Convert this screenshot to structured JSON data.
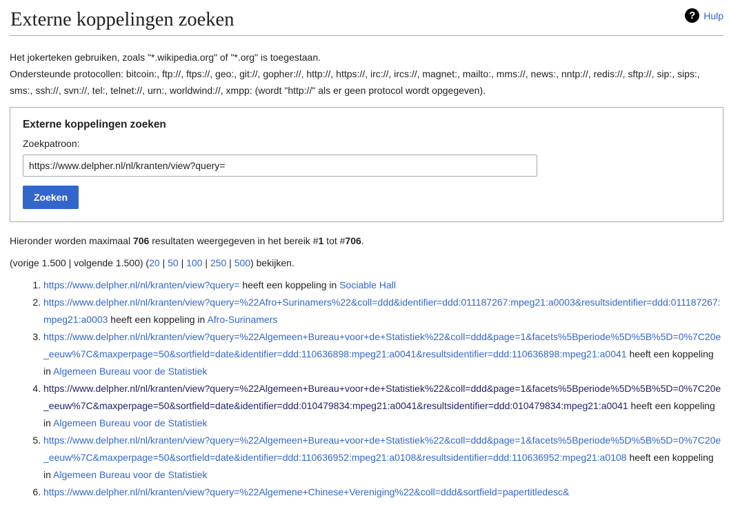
{
  "page": {
    "title": "Externe koppelingen zoeken",
    "help_label": "Hulp",
    "intro_line1": "Het jokerteken gebruiken, zoals \"*.wikipedia.org\" of \"*.org\" is toegestaan.",
    "intro_line2": "Ondersteunde protocollen: bitcoin:, ftp://, ftps://, geo:, git://, gopher://, http://, https://, irc://, ircs://, magnet:, mailto:, mms://, news:, nntp://, redis://, sftp://, sip:, sips:, sms:, ssh://, svn://, tel:, telnet://, urn:, worldwind://, xmpp: (wordt \"http://\" als er geen protocol wordt opgegeven)."
  },
  "form": {
    "legend": "Externe koppelingen zoeken",
    "field_label": "Zoekpatroon:",
    "field_value": "https://www.delpher.nl/nl/kranten/view?query=",
    "submit_label": "Zoeken"
  },
  "summary": {
    "prefix": "Hieronder worden maximaal ",
    "count": "706",
    "middle": " resultaten weergegeven in het bereik #",
    "from": "1",
    "between": " tot #",
    "to": "706",
    "suffix": "."
  },
  "paging": {
    "open": "(vorige 1.500 | volgende 1.500) (",
    "sizes": [
      "20",
      "50",
      "100",
      "250",
      "500"
    ],
    "sep": " | ",
    "close": ") bekijken."
  },
  "results": {
    "connector": " heeft een koppeling in ",
    "items": [
      {
        "url": "https://www.delpher.nl/nl/kranten/view?query=",
        "page": "Sociable Hall",
        "visited": false
      },
      {
        "url": "https://www.delpher.nl/nl/kranten/view?query=%22Afro+Surinamers%22&coll=ddd&identifier=ddd:011187267:mpeg21:a0003&resultsidentifier=ddd:011187267:mpeg21:a0003",
        "page": "Afro-Surinamers",
        "visited": false
      },
      {
        "url": "https://www.delpher.nl/nl/kranten/view?query=%22Algemeen+Bureau+voor+de+Statistiek%22&coll=ddd&page=1&facets%5Bperiode%5D%5B%5D=0%7C20e_eeuw%7C&maxperpage=50&sortfield=date&identifier=ddd:110636898:mpeg21:a0041&resultsidentifier=ddd:110636898:mpeg21:a0041",
        "page": "Algemeen Bureau voor de Statistiek",
        "visited": false
      },
      {
        "url": "https://www.delpher.nl/nl/kranten/view?query=%22Algemeen+Bureau+voor+de+Statistiek%22&coll=ddd&page=1&facets%5Bperiode%5D%5B%5D=0%7C20e_eeuw%7C&maxperpage=50&sortfield=date&identifier=ddd:010479834:mpeg21:a0041&resultsidentifier=ddd:010479834:mpeg21:a0041",
        "page": "Algemeen Bureau voor de Statistiek",
        "visited": true
      },
      {
        "url": "https://www.delpher.nl/nl/kranten/view?query=%22Algemeen+Bureau+voor+de+Statistiek%22&coll=ddd&page=1&facets%5Bperiode%5D%5B%5D=0%7C20e_eeuw%7C&maxperpage=50&sortfield=date&identifier=ddd:110636952:mpeg21:a0108&resultsidentifier=ddd:110636952:mpeg21:a0108",
        "page": "Algemeen Bureau voor de Statistiek",
        "visited": false
      },
      {
        "url": "https://www.delpher.nl/nl/kranten/view?query=%22Algemene+Chinese+Vereniging%22&coll=ddd&sortfield=papertitledesc&",
        "page": "",
        "visited": false
      }
    ]
  },
  "colors": {
    "link": "#3366cc",
    "visited": "#222266",
    "button": "#3366cc",
    "text": "#202122",
    "border": "#a2a9b1"
  }
}
